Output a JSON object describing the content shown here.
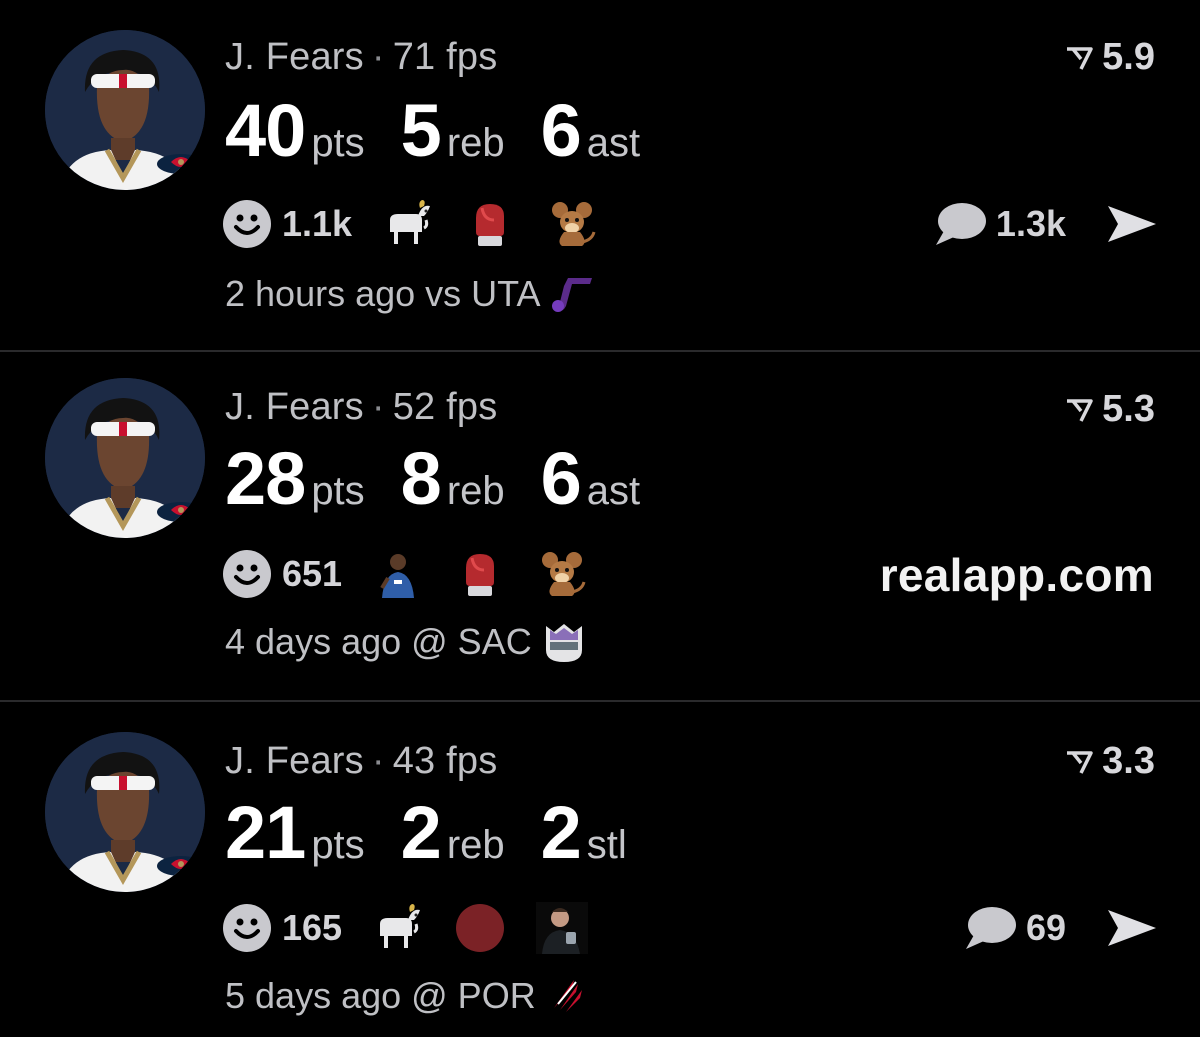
{
  "colors": {
    "background": "#000000",
    "divider": "#2a2a2c",
    "primary_text": "#ffffff",
    "secondary_text": "#bfc0c4",
    "avatar_bg": "#1c2a45",
    "jazz_purple": "#5b2b8a",
    "kings_purple": "#8a6fb8",
    "blazers_red": "#c8102e",
    "dark_red_circle": "#7b2226"
  },
  "watermark": "realapp.com",
  "posts": [
    {
      "player": "J. Fears",
      "separator": "·",
      "fps": "71 fps",
      "rating": "5.9",
      "stats": [
        {
          "value": "40",
          "unit": "pts"
        },
        {
          "value": "5",
          "unit": "reb"
        },
        {
          "value": "6",
          "unit": "ast"
        }
      ],
      "reaction_count": "1.1k",
      "reaction_icons": [
        "goat-icon",
        "boxing-glove-icon",
        "cartoon-mouse-icon"
      ],
      "comment_count": "1.3k",
      "time_text": "2 hours ago vs UTA",
      "team_logo": "jazz-logo"
    },
    {
      "player": "J. Fears",
      "separator": "·",
      "fps": "52 fps",
      "rating": "5.3",
      "stats": [
        {
          "value": "28",
          "unit": "pts"
        },
        {
          "value": "8",
          "unit": "reb"
        },
        {
          "value": "6",
          "unit": "ast"
        }
      ],
      "reaction_count": "651",
      "reaction_icons": [
        "player-photo-icon",
        "boxing-glove-icon",
        "cartoon-mouse-icon"
      ],
      "time_text": "4 days ago @ SAC",
      "team_logo": "kings-logo"
    },
    {
      "player": "J. Fears",
      "separator": "·",
      "fps": "43 fps",
      "rating": "3.3",
      "stats": [
        {
          "value": "21",
          "unit": "pts"
        },
        {
          "value": "2",
          "unit": "reb"
        },
        {
          "value": "2",
          "unit": "stl"
        }
      ],
      "reaction_count": "165",
      "reaction_icons": [
        "goat-icon",
        "red-circle-icon",
        "person-photo-icon"
      ],
      "comment_count": "69",
      "time_text": "5 days ago @ POR",
      "team_logo": "blazers-logo"
    }
  ]
}
